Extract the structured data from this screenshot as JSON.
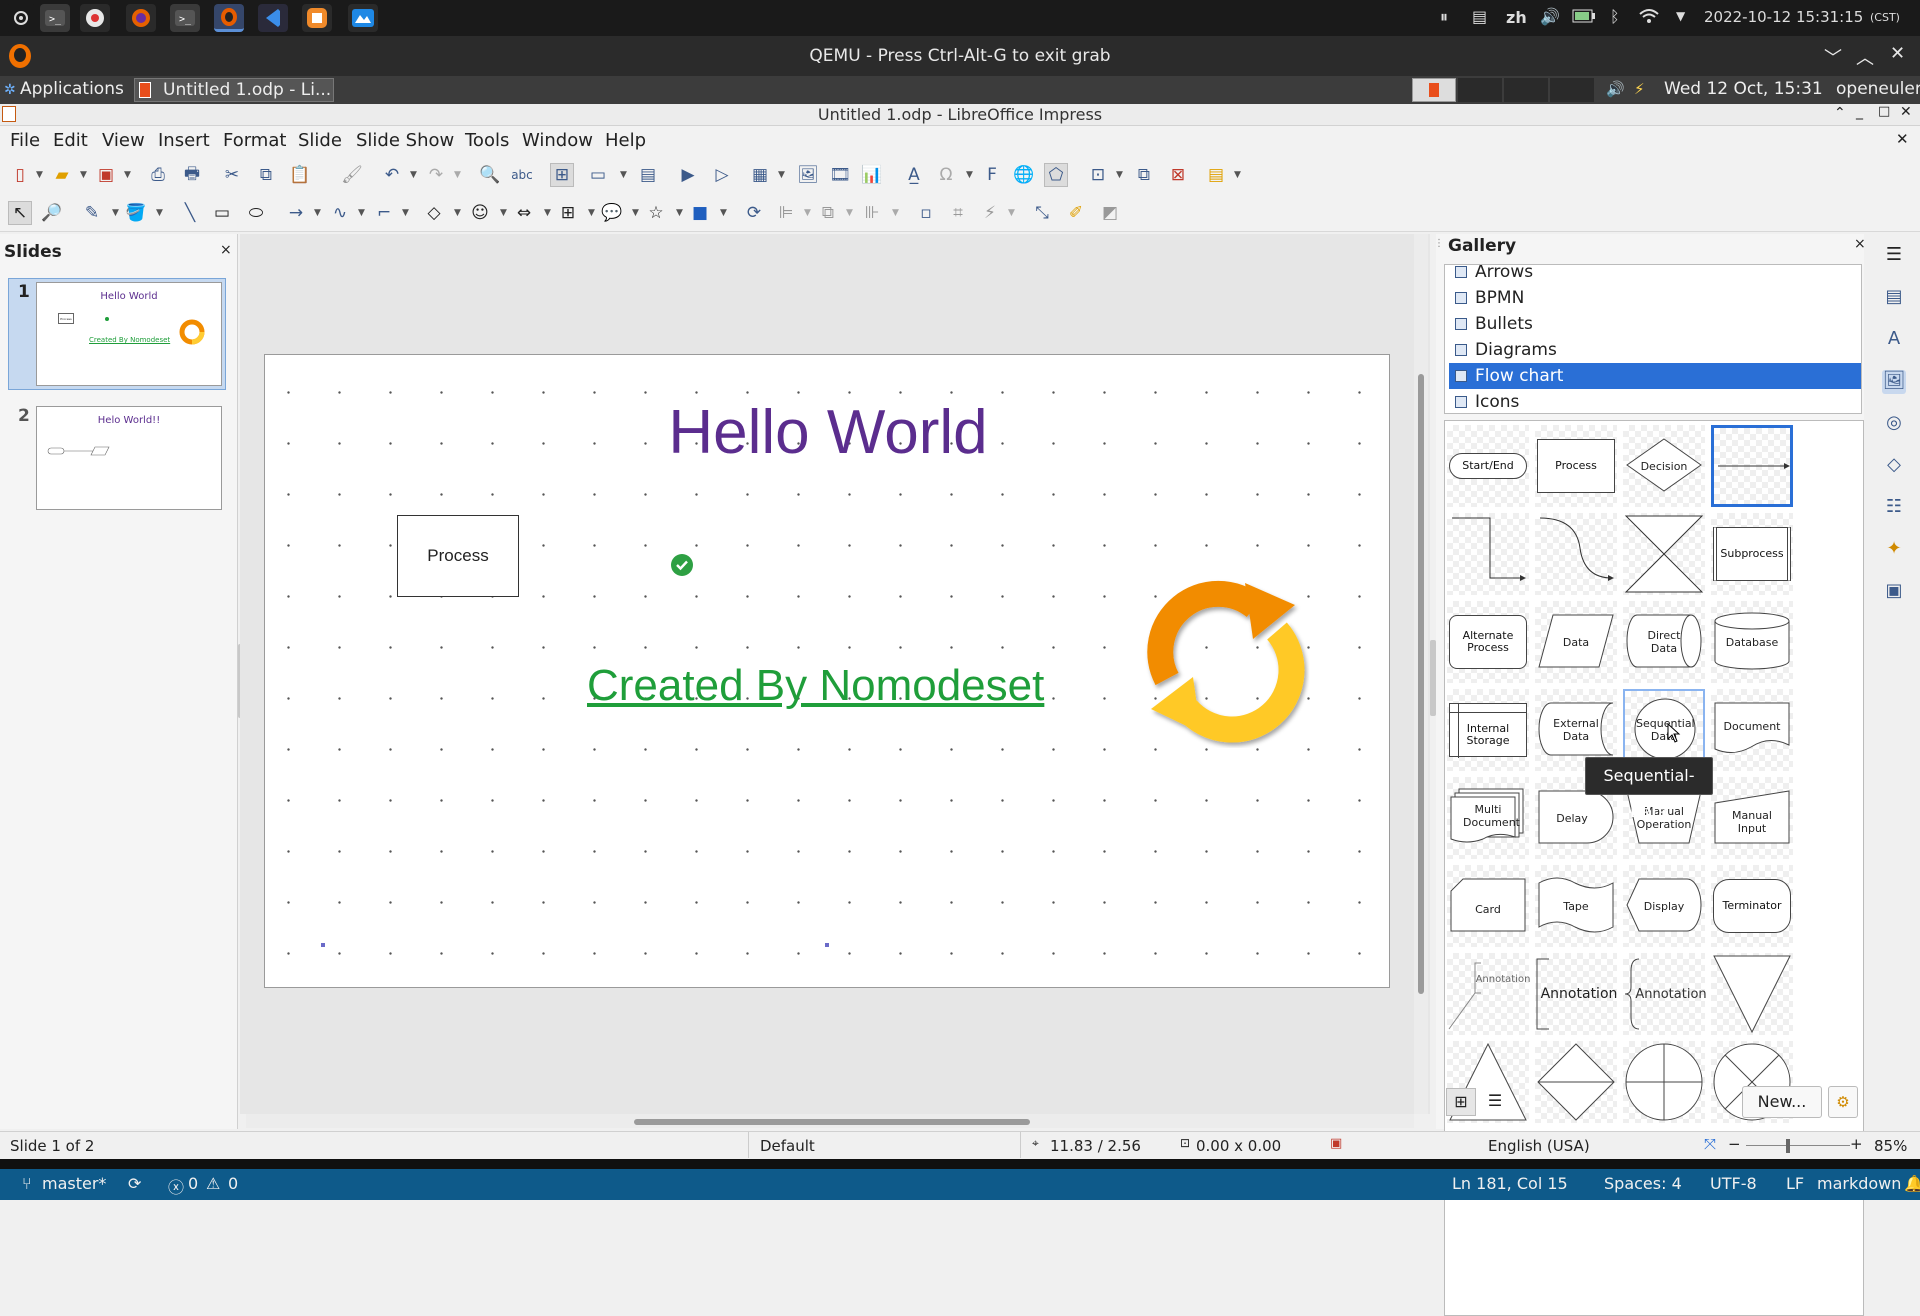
{
  "host": {
    "indicators": [
      "⏸",
      "▤"
    ],
    "lang": "zh",
    "datetime": "2022-10-12 15:31:15",
    "tz": "(CST)",
    "app_icons": [
      "start-icon",
      "terminal-icon",
      "app-icon",
      "firefox-icon",
      "terminal-icon",
      "qemu-icon",
      "vscode-icon",
      "app-icon",
      "app-icon"
    ]
  },
  "qemu": {
    "title": "QEMU - Press Ctrl-Alt-G to exit grab"
  },
  "guest": {
    "applications": "Applications",
    "task": "Untitled 1.odp - Li...",
    "datetime": "Wed 12 Oct, 15:31",
    "user": "openeuler"
  },
  "lo": {
    "title": "Untitled 1.odp - LibreOffice Impress",
    "menu": [
      "File",
      "Edit",
      "View",
      "Insert",
      "Format",
      "Slide",
      "Slide Show",
      "Tools",
      "Window",
      "Help"
    ]
  },
  "slides_panel": {
    "title": "Slides",
    "close": "×",
    "thumbs": [
      {
        "number": "1",
        "title": "Hello World",
        "process": "Process",
        "link": "Created By Nomodeset"
      },
      {
        "number": "2",
        "title": "Helo World!!"
      }
    ]
  },
  "slide": {
    "title": "Hello World",
    "process_label": "Process",
    "link_text": "Created By Nomodeset"
  },
  "gallery": {
    "title": "Gallery",
    "close": "×",
    "categories": [
      "Arrows",
      "BPMN",
      "Bullets",
      "Diagrams",
      "Flow chart",
      "Icons"
    ],
    "selected_category": "Flow chart",
    "items": {
      "start_end": "Start/End",
      "process": "Process",
      "decision": "Decision",
      "subprocess": "Subprocess",
      "alternate_process": "Alternate Process",
      "data": "Data",
      "direct_data": "Direct Data",
      "database": "Database",
      "internal_storage": "Internal Storage",
      "external_data": "External Data",
      "sequential_data": "Sequential Data",
      "document": "Document",
      "multi_document": "Multi Document",
      "delay": "Delay",
      "manual_operation": "Manual Operation",
      "manual_input": "Manual Input",
      "card": "Card",
      "tape": "Tape",
      "display": "Display",
      "terminator": "Terminator",
      "annotation1": "Annotation",
      "annotation2": "Annotation",
      "annotation3": "Annotation"
    },
    "tooltip": "Sequential-Data",
    "new_button": "New..."
  },
  "statusbar": {
    "slide_info": "Slide 1 of 2",
    "layout": "Default",
    "position": "11.83 / 2.56",
    "size": "0.00 x 0.00",
    "language": "English (USA)",
    "zoom_minus": "−",
    "zoom_plus": "+",
    "zoom": "85%"
  },
  "vscode": {
    "branch": "master*",
    "errors": "0",
    "warnings": "0",
    "position": "Ln 181, Col 15",
    "spaces": "Spaces: 4",
    "encoding": "UTF-8",
    "eol": "LF",
    "language": "markdown"
  },
  "colors": {
    "title_purple": "#5b2d8e",
    "link_green": "#1f9e3a",
    "selection_blue": "#2a6fd6",
    "vscode_blue": "#0e5a8a"
  }
}
